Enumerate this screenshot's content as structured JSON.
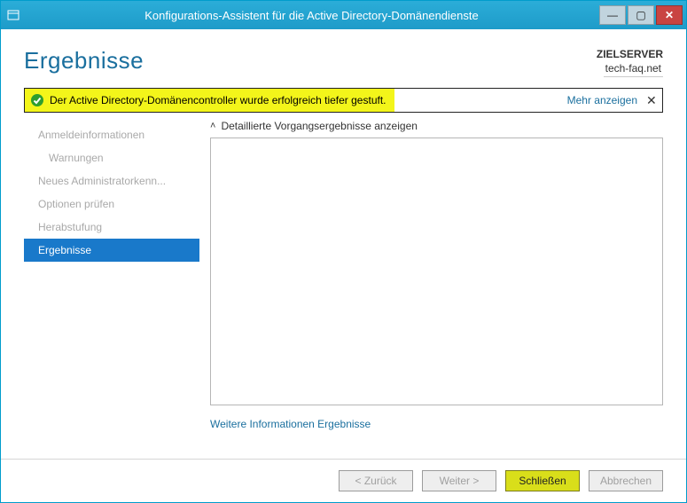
{
  "window": {
    "title": "Konfigurations-Assistent für die Active Directory-Domänendienste"
  },
  "header": {
    "heading": "Ergebnisse",
    "target_label": "ZIELSERVER",
    "target_value": "tech-faq.net"
  },
  "banner": {
    "message": "Der Active Directory-Domänencontroller wurde erfolgreich tiefer gestuft.",
    "more_label": "Mehr anzeigen"
  },
  "nav": {
    "items": [
      {
        "label": "Anmeldeinformationen",
        "selected": false,
        "sub": false
      },
      {
        "label": "Warnungen",
        "selected": false,
        "sub": true
      },
      {
        "label": "Neues Administratorkenn...",
        "selected": false,
        "sub": false
      },
      {
        "label": "Optionen prüfen",
        "selected": false,
        "sub": false
      },
      {
        "label": "Herabstufung",
        "selected": false,
        "sub": false
      },
      {
        "label": "Ergebnisse",
        "selected": true,
        "sub": false
      }
    ]
  },
  "content": {
    "expander_label": "Detaillierte Vorgangsergebnisse anzeigen",
    "more_info_link": "Weitere Informationen Ergebnisse"
  },
  "footer": {
    "back": "< Zurück",
    "next": "Weiter >",
    "close": "Schließen",
    "cancel": "Abbrechen"
  }
}
